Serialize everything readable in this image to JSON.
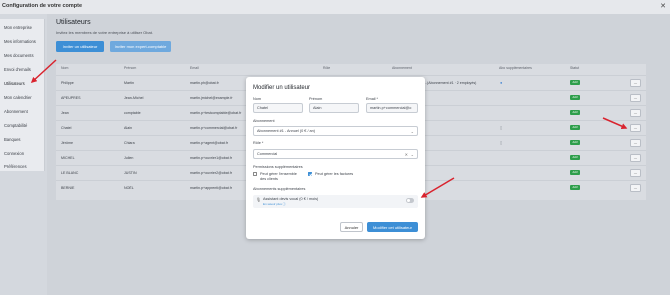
{
  "window": {
    "title": "Configuration de votre compte",
    "close_icon": "close-icon"
  },
  "sidebar": {
    "items": [
      {
        "label": "Mon entreprise"
      },
      {
        "label": "Mes informations"
      },
      {
        "label": "Mes documents"
      },
      {
        "label": "Envoi d'emails"
      },
      {
        "label": "Utilisateurs"
      },
      {
        "label": "Mon calendrier"
      },
      {
        "label": "Abonnement"
      },
      {
        "label": "Comptabilité"
      },
      {
        "label": "Banques"
      },
      {
        "label": "Connexion"
      },
      {
        "label": "Préférences"
      }
    ]
  },
  "main": {
    "title": "Utilisateurs",
    "subtitle": "Invitez les membres de votre entreprise à utiliser Obat.",
    "add_button": "Inviter un utilisateur",
    "import_button": "Inviter mon expert-comptable"
  },
  "table": {
    "headers": [
      "Nom",
      "Prénom",
      "Email",
      "Rôle",
      "Abonnement",
      "Abo supplémentaires",
      "Statut"
    ],
    "rows": [
      {
        "nom": "Philippe",
        "prenom": "Martin",
        "email": "martin.ph@obat.fr",
        "abonnement": "...(Abonnement #1 · 2 employés)",
        "statut": "Actif",
        "extra": true
      },
      {
        "nom": "APEUPRES",
        "prenom": "Jean-Michel",
        "email": "martin.jmichel@example.fr",
        "abonnement": "",
        "statut": "Actif",
        "extra": false
      },
      {
        "nom": "Jean",
        "prenom": "comptable",
        "email": "martin.p+testcomptable@obat.fr",
        "abonnement": "",
        "statut": "Actif",
        "extra": false
      },
      {
        "nom": "Chatel",
        "prenom": "Alain",
        "email": "martin.p+commercial@obat.fr",
        "abonnement": "",
        "statut": "Actif",
        "extra": true
      },
      {
        "nom": "Jérôme",
        "prenom": "Chiara",
        "email": "martin.p+agent@obat.fr",
        "abonnement": "",
        "statut": "Actif",
        "extra": true
      },
      {
        "nom": "MICHEL",
        "prenom": "Julien",
        "email": "martin.p+ouvrier1@obat.fr",
        "abonnement": "",
        "statut": "Actif",
        "extra": false
      },
      {
        "nom": "LE BLANC",
        "prenom": "JUSTIN",
        "email": "martin.p+ouvrier2@obat.fr",
        "abonnement": "",
        "statut": "Actif",
        "extra": false
      },
      {
        "nom": "BERNIE",
        "prenom": "NOËL",
        "email": "martin.p+apprenti@obat.fr",
        "abonnement": "",
        "statut": "Actif",
        "extra": false
      }
    ],
    "more_label": "···"
  },
  "modal": {
    "title": "Modifier un utilisateur",
    "nom_label": "Nom",
    "nom_value": "Chatel",
    "prenom_label": "Prénom",
    "prenom_value": "Alain",
    "email_label": "Email *",
    "email_value": "martin.p+commercial@o",
    "abonnement_label": "Abonnement",
    "abonnement_value": "Abonnement #1 - Annuel (0 € / an)",
    "role_label": "Rôle *",
    "role_value": "Commercial",
    "permissions_label": "Permissions supplémentaires",
    "perm1_line1": "Peut gérer l'ensemble",
    "perm1_line2": "des clients",
    "perm2_label": "Peut gérer les factures",
    "addons_label": "Abonnements supplémentaires",
    "addon_name": "Assistant devis vocal (0 € / mois)",
    "addon_link": "En savoir plus ⓘ",
    "cancel": "Annuler",
    "submit": "Modifier cet utilisateur",
    "accent": "#3d8fd6"
  },
  "annotation_color": "#d9232e"
}
